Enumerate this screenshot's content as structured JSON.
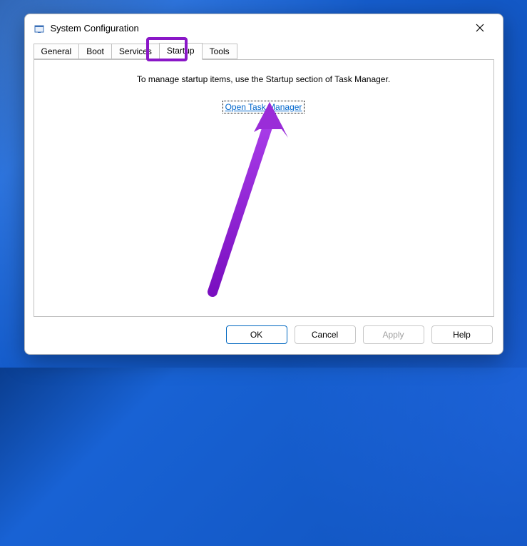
{
  "window": {
    "title": "System Configuration"
  },
  "tabs": {
    "general": "General",
    "boot": "Boot",
    "services": "Services",
    "startup": "Startup",
    "tools": "Tools"
  },
  "startup_panel": {
    "message": "To manage startup items, use the Startup section of Task Manager.",
    "link": "Open Task Manager"
  },
  "buttons": {
    "ok": "OK",
    "cancel": "Cancel",
    "apply": "Apply",
    "help": "Help"
  }
}
